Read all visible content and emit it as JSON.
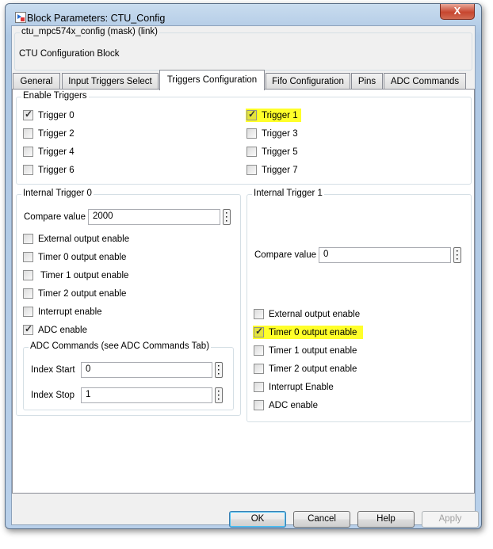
{
  "window": {
    "title": "Block Parameters: CTU_Config",
    "close_label": "X"
  },
  "mask": {
    "header": "ctu_mpc574x_config (mask) (link)",
    "description": "CTU Configuration Block"
  },
  "tabs": [
    {
      "label": "General"
    },
    {
      "label": "Input Triggers Select"
    },
    {
      "label": "Triggers Configuration",
      "active": true
    },
    {
      "label": "Fifo Configuration"
    },
    {
      "label": "Pins"
    },
    {
      "label": "ADC Commands"
    }
  ],
  "enable_triggers": {
    "title": "Enable Triggers",
    "items": [
      {
        "label": "Trigger 0",
        "checked": true
      },
      {
        "label": "Trigger 1",
        "checked": true
      },
      {
        "label": "Trigger 2",
        "checked": false
      },
      {
        "label": "Trigger 3",
        "checked": false
      },
      {
        "label": "Trigger 4",
        "checked": false
      },
      {
        "label": "Trigger 5",
        "checked": false
      },
      {
        "label": "Trigger 6",
        "checked": false
      },
      {
        "label": "Trigger 7",
        "checked": false
      }
    ]
  },
  "trigger0": {
    "title": "Internal Trigger 0",
    "compare_label": "Compare value",
    "compare_value": "2000",
    "options": [
      {
        "label": "External output enable",
        "checked": false
      },
      {
        "label": "Timer 0 output enable",
        "checked": false
      },
      {
        "label": " Timer 1 output enable",
        "checked": false
      },
      {
        "label": "Timer 2 output enable",
        "checked": false
      },
      {
        "label": "Interrupt enable",
        "checked": false
      },
      {
        "label": "ADC enable",
        "checked": true
      }
    ],
    "adc": {
      "title": "ADC Commands (see ADC Commands Tab)",
      "start_label": "Index Start",
      "start_value": "0",
      "stop_label": "Index Stop",
      "stop_value": "1"
    }
  },
  "trigger1": {
    "title": "Internal Trigger 1",
    "compare_label": "Compare value",
    "compare_value": "0",
    "options": [
      {
        "label": "External output enable",
        "checked": false
      },
      {
        "label": "Timer 0 output enable",
        "checked": true
      },
      {
        "label": "Timer 1 output enable",
        "checked": false
      },
      {
        "label": "Timer 2 output enable",
        "checked": false
      },
      {
        "label": "Interrupt Enable",
        "checked": false
      },
      {
        "label": "ADC enable",
        "checked": false
      }
    ]
  },
  "buttons": {
    "ok": "OK",
    "cancel": "Cancel",
    "help": "Help",
    "apply": "Apply"
  },
  "colors": {
    "highlight": "#ffff2a"
  }
}
